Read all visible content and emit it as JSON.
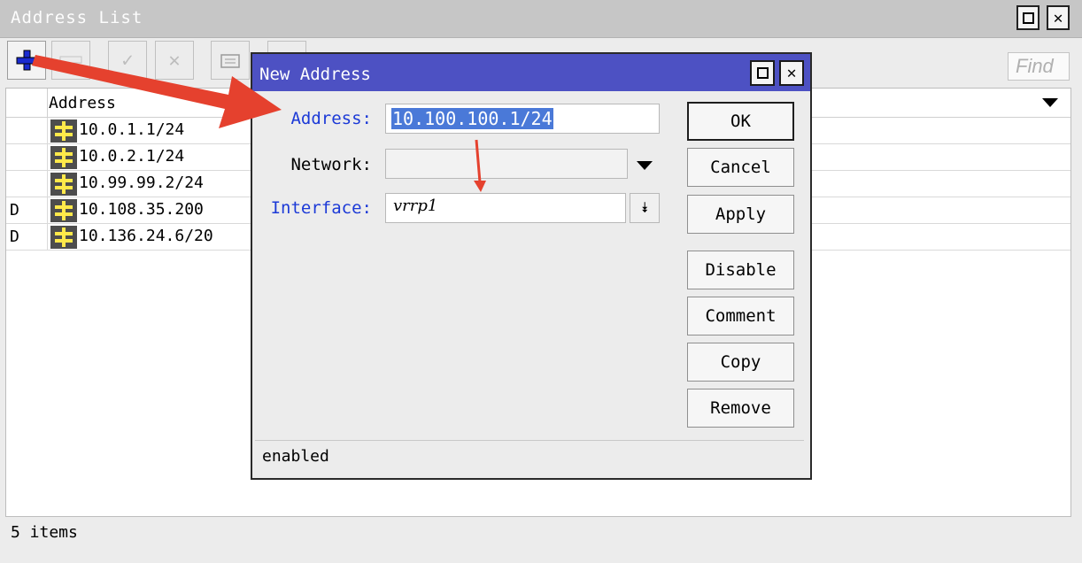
{
  "window": {
    "title": "Address List",
    "find_placeholder": "Find",
    "toolbar": {
      "add_icon": "plus-icon",
      "remove_icon": "minus-icon",
      "enable_icon": "check-icon",
      "disable_icon": "cross-icon",
      "comment_icon": "note-icon",
      "filter_icon": "filter-icon"
    },
    "table": {
      "columns": [
        "Address"
      ],
      "rows": [
        {
          "flag": "",
          "address": "10.0.1.1/24"
        },
        {
          "flag": "",
          "address": "10.0.2.1/24"
        },
        {
          "flag": "",
          "address": "10.99.99.2/24"
        },
        {
          "flag": "D",
          "address": "10.108.35.200"
        },
        {
          "flag": "D",
          "address": "10.136.24.6/20"
        }
      ]
    },
    "status": "5 items"
  },
  "dialog": {
    "title": "New Address",
    "fields": {
      "address_label": "Address:",
      "address_value": "10.100.100.1/24",
      "network_label": "Network:",
      "network_value": "",
      "interface_label": "Interface:",
      "interface_value": "vrrp1"
    },
    "buttons": {
      "ok": "OK",
      "cancel": "Cancel",
      "apply": "Apply",
      "disable": "Disable",
      "comment": "Comment",
      "copy": "Copy",
      "remove": "Remove"
    },
    "status": "enabled"
  },
  "colors": {
    "dialog_titlebar": "#4d51c3",
    "label_blue": "#1c3ad7",
    "selection": "#4a79d8",
    "annotation_arrow": "#e5412e",
    "add_icon": "#1a2bd0"
  }
}
